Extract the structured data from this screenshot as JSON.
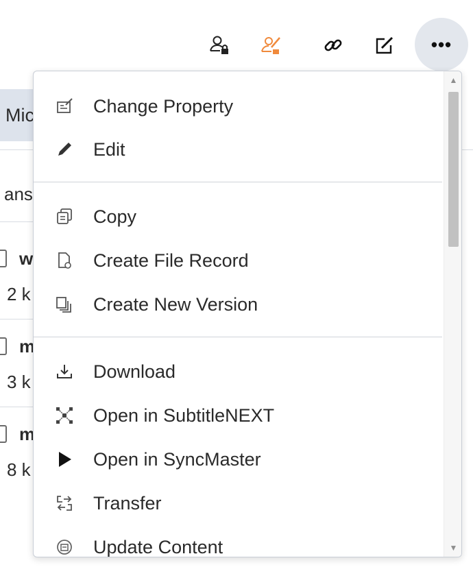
{
  "toolbar": {
    "icons": [
      "user-lock-icon",
      "user-edit-lock-icon",
      "link-icon",
      "edit-note-icon"
    ],
    "more_label": "•••",
    "accent": "#f08a3c"
  },
  "background": {
    "tab_label": "Mic",
    "section_label": "ans",
    "rows": [
      {
        "name": "w",
        "size": "2 k"
      },
      {
        "name": "m",
        "size": "3 k"
      },
      {
        "name": "m",
        "size": "8 k"
      }
    ]
  },
  "menu": {
    "groups": [
      [
        {
          "label": "Change Property",
          "icon": "property-sheet-icon"
        },
        {
          "label": "Edit",
          "icon": "pencil-icon"
        }
      ],
      [
        {
          "label": "Copy",
          "icon": "copy-icon"
        },
        {
          "label": "Create File Record",
          "icon": "file-record-icon"
        },
        {
          "label": "Create New Version",
          "icon": "new-version-icon"
        }
      ],
      [
        {
          "label": "Download",
          "icon": "download-icon"
        },
        {
          "label": "Open in SubtitleNEXT",
          "icon": "subtitlenext-icon"
        },
        {
          "label": "Open in SyncMaster",
          "icon": "play-icon"
        },
        {
          "label": "Transfer",
          "icon": "transfer-icon"
        },
        {
          "label": "Update Content",
          "icon": "update-content-icon"
        }
      ]
    ]
  },
  "colors": {
    "menu_border": "#c9ced6",
    "selected_bg": "#dde3ec",
    "more_button_bg": "#e3e7ed"
  }
}
